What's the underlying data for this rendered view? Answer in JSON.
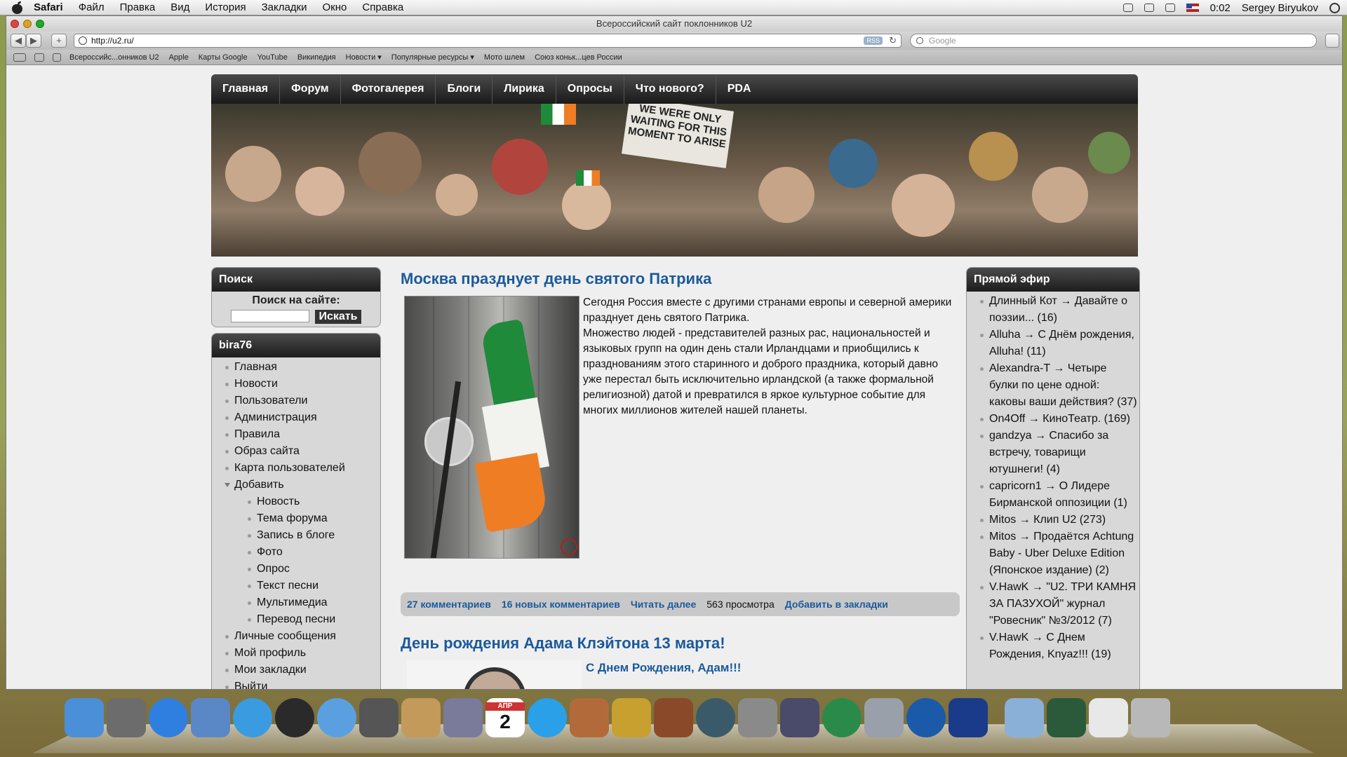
{
  "menubar": {
    "app": "Safari",
    "items": [
      "Файл",
      "Правка",
      "Вид",
      "История",
      "Закладки",
      "Окно",
      "Справка"
    ],
    "clock": "0:02",
    "user": "Sergey Biryukov"
  },
  "window": {
    "title": "Всероссийский сайт поклонников U2"
  },
  "toolbar": {
    "back": "◀",
    "forward": "▶",
    "add": "+",
    "url": "http://u2.ru/",
    "rss": "RSS",
    "reload": "↻",
    "search_placeholder": "Google"
  },
  "bookmarks": [
    "Всероссийс...онников U2",
    "Apple",
    "Карты Google",
    "YouTube",
    "Википедия",
    "Новости ▾",
    "Популярные ресурсы ▾",
    "Мото шлем",
    "Союз коньк...цев России"
  ],
  "site": {
    "nav": [
      "Главная",
      "Форум",
      "Фотогалерея",
      "Блоги",
      "Лирика",
      "Опросы",
      "Что нового?",
      "PDA"
    ],
    "banner_sign": "WE WERE ONLY WAITING FOR THIS MOMENT TO ARISE",
    "search_box": {
      "title": "Поиск",
      "label": "Поиск на сайте:",
      "button": "Искать"
    },
    "user_box": {
      "title": "bira76",
      "items": [
        "Главная",
        "Новости",
        "Пользователи",
        "Администрация",
        "Правила",
        "Образ сайта",
        "Карта пользователей",
        "Добавить"
      ],
      "sub_items": [
        "Новость",
        "Тема форума",
        "Запись в блоге",
        "Фото",
        "Опрос",
        "Текст песни",
        "Мультимедиа",
        "Перевод песни"
      ],
      "bottom_items": [
        "Личные сообщения",
        "Мой профиль",
        "Мои закладки",
        "Выйти"
      ]
    },
    "article1": {
      "title": "Москва празднует день святого Патрика",
      "p1": "Сегодня Россия вместе с другими странами европы и северной америки празднует день святого Патрика.",
      "p2": "Множество людей - представителей разных рас, национальностей и языковых групп на один день стали Ирландцами и приобщились к празднованиям этого старинного и доброго праздника, который давно уже перестал быть исключительно ирландской (а также формальной религиозной) датой и превратился в яркое культурное событие для многих миллионов жителей нашей планеты.",
      "comments": "27 комментариев",
      "new_comments": "16 новых комментариев",
      "read_more": "Читать далее",
      "views": "563 просмотра",
      "bookmark": "Добавить в закладки"
    },
    "article2": {
      "title": "День рождения Адама Клэйтона 13 марта!",
      "subtitle": "С Днем Рождения, Адам!!!"
    },
    "live": {
      "title": "Прямой эфир",
      "items": [
        "Длинный Кот → Давайте о поэзии... (16)",
        "Alluha → С Днём рождения, Alluha! (11)",
        "Alexandra-T → Четыре булки по цене одной: каковы ваши действия? (37)",
        "On4Off → КиноТеатр. (169)",
        "gandzya → Спасибо за встречу, товарищи ютушнеги! (4)",
        "capricorn1 → О Лидере Бирманской оппозиции (1)",
        "Mitos → Клип U2 (273)",
        "Mitos → Продаётся Achtung Baby - Uber Deluxe Edition (Японское издание) (2)",
        "V.HawK → \"U2. ТРИ КАМНЯ ЗА ПАЗУХОЙ\" журнал \"Ровесник\" №3/2012 (7)",
        "V.HawK → С Днем Рождения, Knyaz!!! (19)"
      ]
    }
  },
  "dock": {
    "calendar_day": "2",
    "calendar_month": "АПР"
  },
  "colors": {
    "link": "#1a5a9c",
    "nav_bg": "#2a2a2a",
    "sidebar_bg": "#d8d8d8"
  }
}
